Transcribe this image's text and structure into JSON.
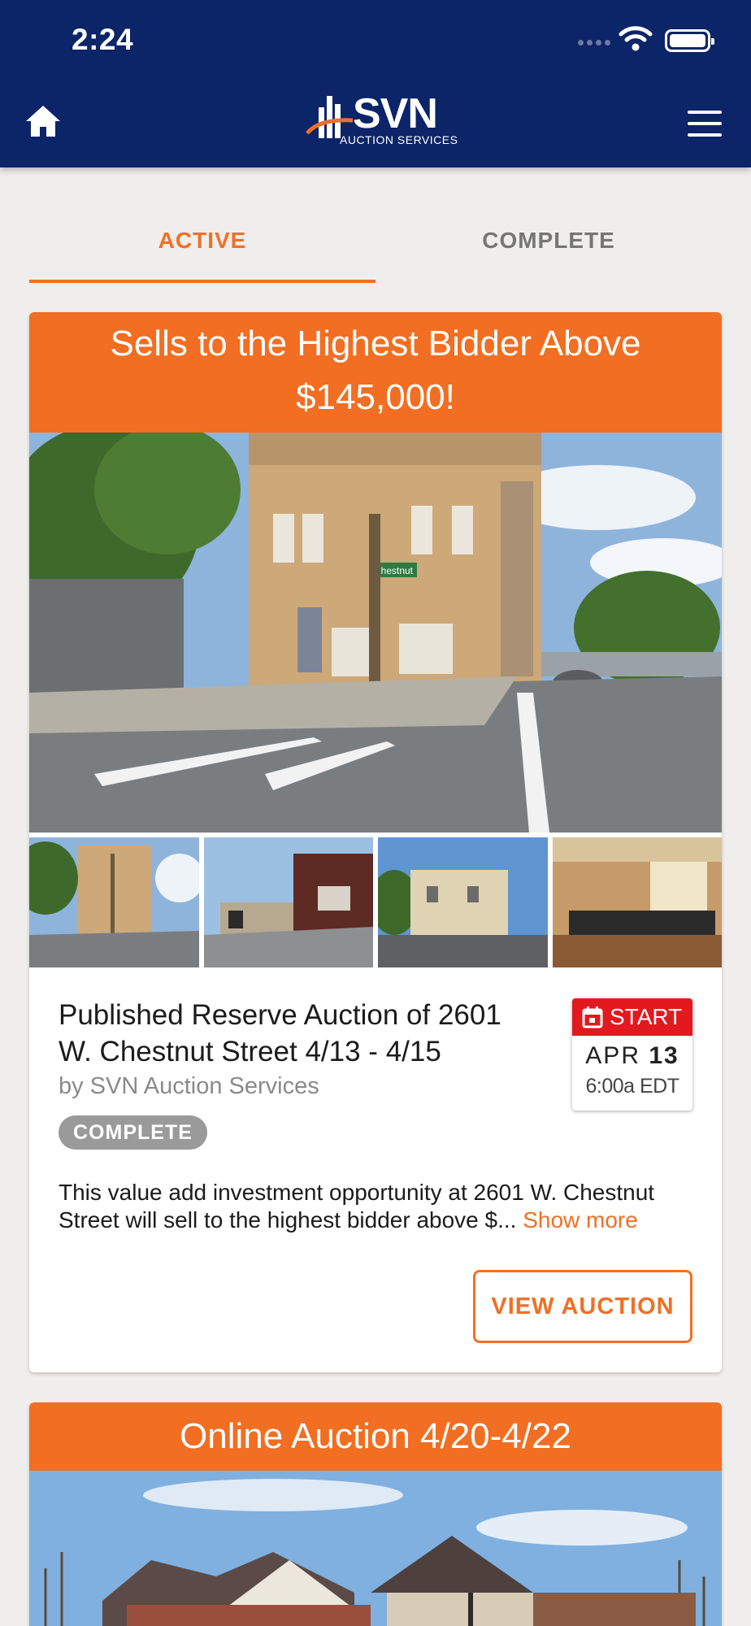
{
  "status_bar": {
    "time": "2:24"
  },
  "header": {
    "logo_text": "SVN",
    "logo_subtext": "AUCTION SERVICES",
    "home_icon": "home-icon",
    "menu_icon": "hamburger-menu-icon",
    "colors": {
      "navbar": "#0c2468",
      "accent": "#f07025"
    }
  },
  "tabs": [
    {
      "label": "ACTIVE",
      "selected": true
    },
    {
      "label": "COMPLETE",
      "selected": false
    }
  ],
  "listings": [
    {
      "banner": "Sells to the Highest Bidder Above $145,000!",
      "title": "Published Reserve Auction of 2601 W. Chestnut Street 4/13 - 4/15",
      "byline": "by SVN Auction Services",
      "status_badge": "COMPLETE",
      "date": {
        "label": "START",
        "month": "APR",
        "day": "13",
        "time": "6:00a EDT"
      },
      "description": "This value add investment opportunity at 2601 W. Chestnut Street will sell to the highest bidder above $...",
      "show_more": "Show more",
      "view_button": "VIEW AUCTION",
      "street_sign": "Chestnut"
    },
    {
      "banner": "Online Auction 4/20-4/22"
    }
  ]
}
